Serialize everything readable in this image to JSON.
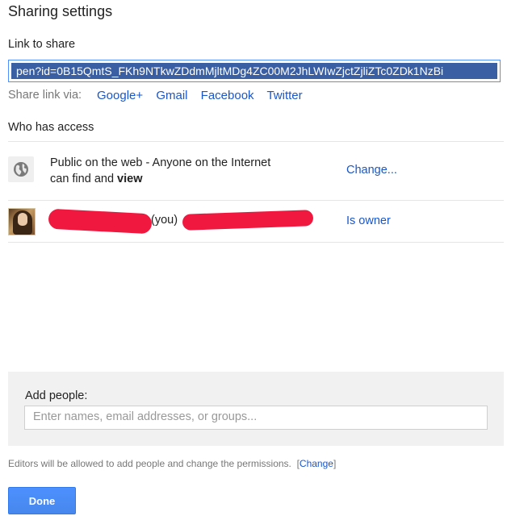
{
  "dialog": {
    "title": "Sharing settings"
  },
  "link_section": {
    "label": "Link to share",
    "url": "pen?id=0B15QmtS_FKh9NTkwZDdmMjltMDg4ZC00M2JhLWIwZjctZjliZTc0ZDk1NzBi"
  },
  "share_via": {
    "label": "Share link via:",
    "services": [
      "Google+",
      "Gmail",
      "Facebook",
      "Twitter"
    ]
  },
  "access_section": {
    "label": "Who has access",
    "public_row": {
      "text_part1": "Public on the web - Anyone on the Internet",
      "text_part2": "can find and ",
      "text_bold": "view",
      "action": "Change...",
      "icon": "globe-icon"
    },
    "owner_row": {
      "you_label": "(you)",
      "role": "Is owner",
      "icon": "avatar"
    }
  },
  "add_people": {
    "label": "Add people:",
    "placeholder": "Enter names, email addresses, or groups..."
  },
  "editors_note": {
    "text": "Editors will be allowed to add people and change the permissions.",
    "open_bracket": "[",
    "link": "Change",
    "close_bracket": "]"
  },
  "done_button": {
    "label": "Done"
  },
  "colors": {
    "link": "#1a56c8",
    "accent": "#4d90fe",
    "selection": "#3b5fa3",
    "redaction": "#f0183e"
  }
}
